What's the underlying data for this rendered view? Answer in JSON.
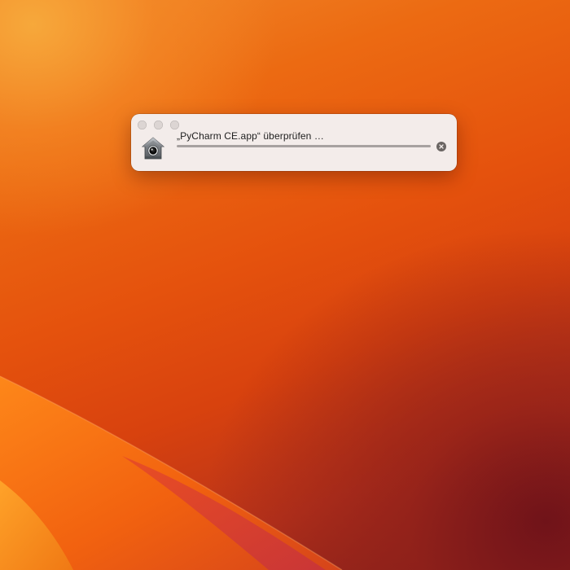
{
  "desktop": {
    "wallpaper": "macOS Ventura orange wallpaper"
  },
  "dialog": {
    "message": "„PyCharm CE.app“ überprüfen …",
    "progress": 1.0,
    "icons": {
      "app": "gatekeeper-security-icon",
      "cancel": "close-circle-icon"
    },
    "window_buttons": [
      "close",
      "minimize",
      "zoom"
    ]
  },
  "colors": {
    "dialog_background": "#f3ecea",
    "progress_track": "#d2cbc9",
    "progress_fill": "#a7a1a0",
    "cancel_button": "#6a6563",
    "traffic_inactive": "#dcd5d3"
  }
}
